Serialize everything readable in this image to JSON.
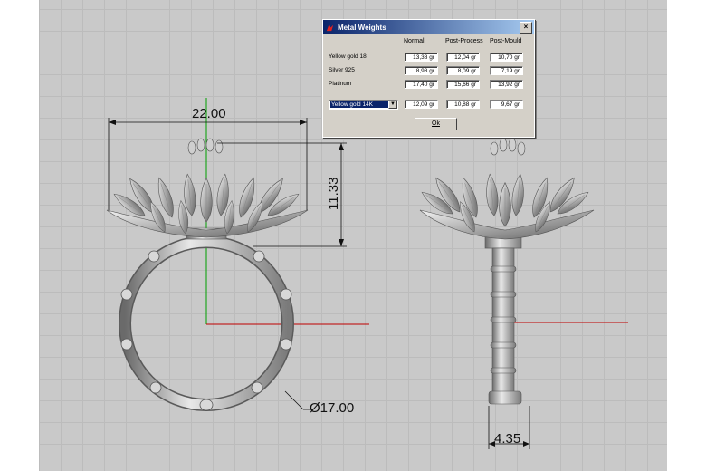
{
  "dialog": {
    "title": "Metal Weights",
    "close_glyph": "×",
    "columns": [
      "Normal",
      "Post-Process",
      "Post-Mould"
    ],
    "rows": [
      {
        "label": "Yellow gold 18",
        "values": [
          "13,38 gr",
          "12,04 gr",
          "10,70 gr"
        ]
      },
      {
        "label": "Silver 925",
        "values": [
          "8,98 gr",
          "8,09 gr",
          "7,19 gr"
        ]
      },
      {
        "label": "Platinum",
        "values": [
          "17,40 gr",
          "15,66 gr",
          "13,92 gr"
        ]
      }
    ],
    "selected_metal": "Yellow gold 14K",
    "selected_values": [
      "12,09 gr",
      "10,88 gr",
      "9,67 gr"
    ],
    "ok_label": "Ok"
  },
  "dimensions": {
    "width": "22.00",
    "height": "11.33",
    "diameter": "Ø17.00",
    "shank": "4.35"
  },
  "colors": {
    "viewport_bg": "#c9c9c9",
    "x_axis": "#c00000",
    "y_axis": "#00a000",
    "titlebar": "#0a246a"
  }
}
